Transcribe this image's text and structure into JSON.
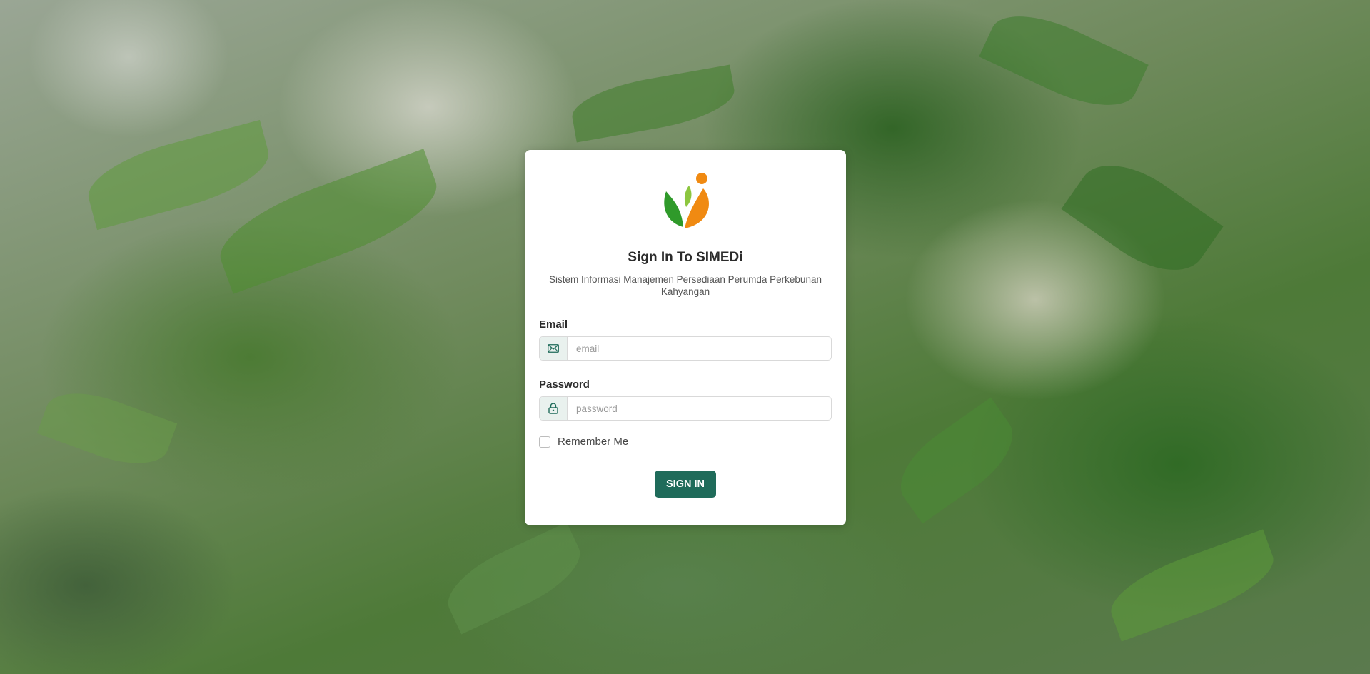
{
  "app": {
    "title": "Sign In To SIMEDi",
    "subtitle": "Sistem Informasi Manajemen Persediaan Perumda Perkebunan Kahyangan",
    "logo_icon": "leaf-sprout-logo-icon"
  },
  "form": {
    "email": {
      "label": "Email",
      "placeholder": "email",
      "value": "",
      "icon": "envelope-icon"
    },
    "password": {
      "label": "Password",
      "placeholder": "password",
      "value": "",
      "icon": "lock-icon"
    },
    "remember": {
      "label": "Remember Me",
      "checked": false
    },
    "submit_label": "SIGN IN"
  },
  "colors": {
    "primary": "#1f6b5a",
    "logo_green": "#2f9a2a",
    "logo_orange": "#f08a12",
    "addon_bg": "#e9f1ee"
  }
}
